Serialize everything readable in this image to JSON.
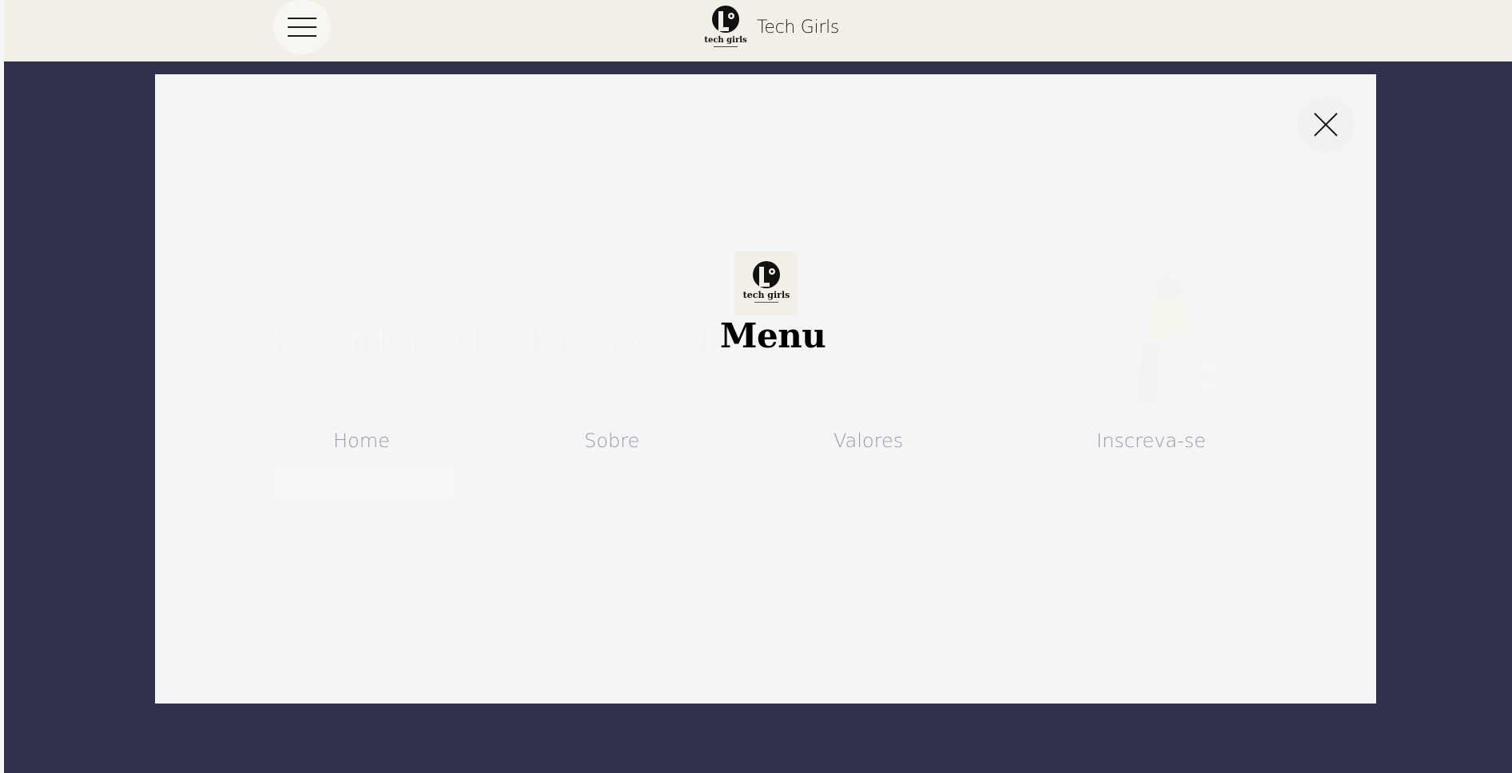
{
  "header": {
    "brand_name": "Tech Girls",
    "logo_text": "tech girls"
  },
  "hero": {
    "title": "Eventos de Tecnologias",
    "subtitle": "Encontre eventos online e presenciais sobre tecnologia para a inclusão de mulheres cis e trans",
    "cta_label": "Marque sua presença"
  },
  "menu": {
    "title": "Menu",
    "logo_text": "tech girls",
    "items": [
      {
        "label": "Home"
      },
      {
        "label": "Sobre"
      },
      {
        "label": "Valores"
      },
      {
        "label": "Inscreva-se"
      }
    ]
  },
  "colors": {
    "header_bg": "#f2efe7",
    "page_bg": "#31314d",
    "modal_bg": "#f4f5f7",
    "nav_text": "#9a9a9e"
  },
  "icons": {
    "menu_toggle": "hamburger-icon",
    "close": "close-icon"
  }
}
